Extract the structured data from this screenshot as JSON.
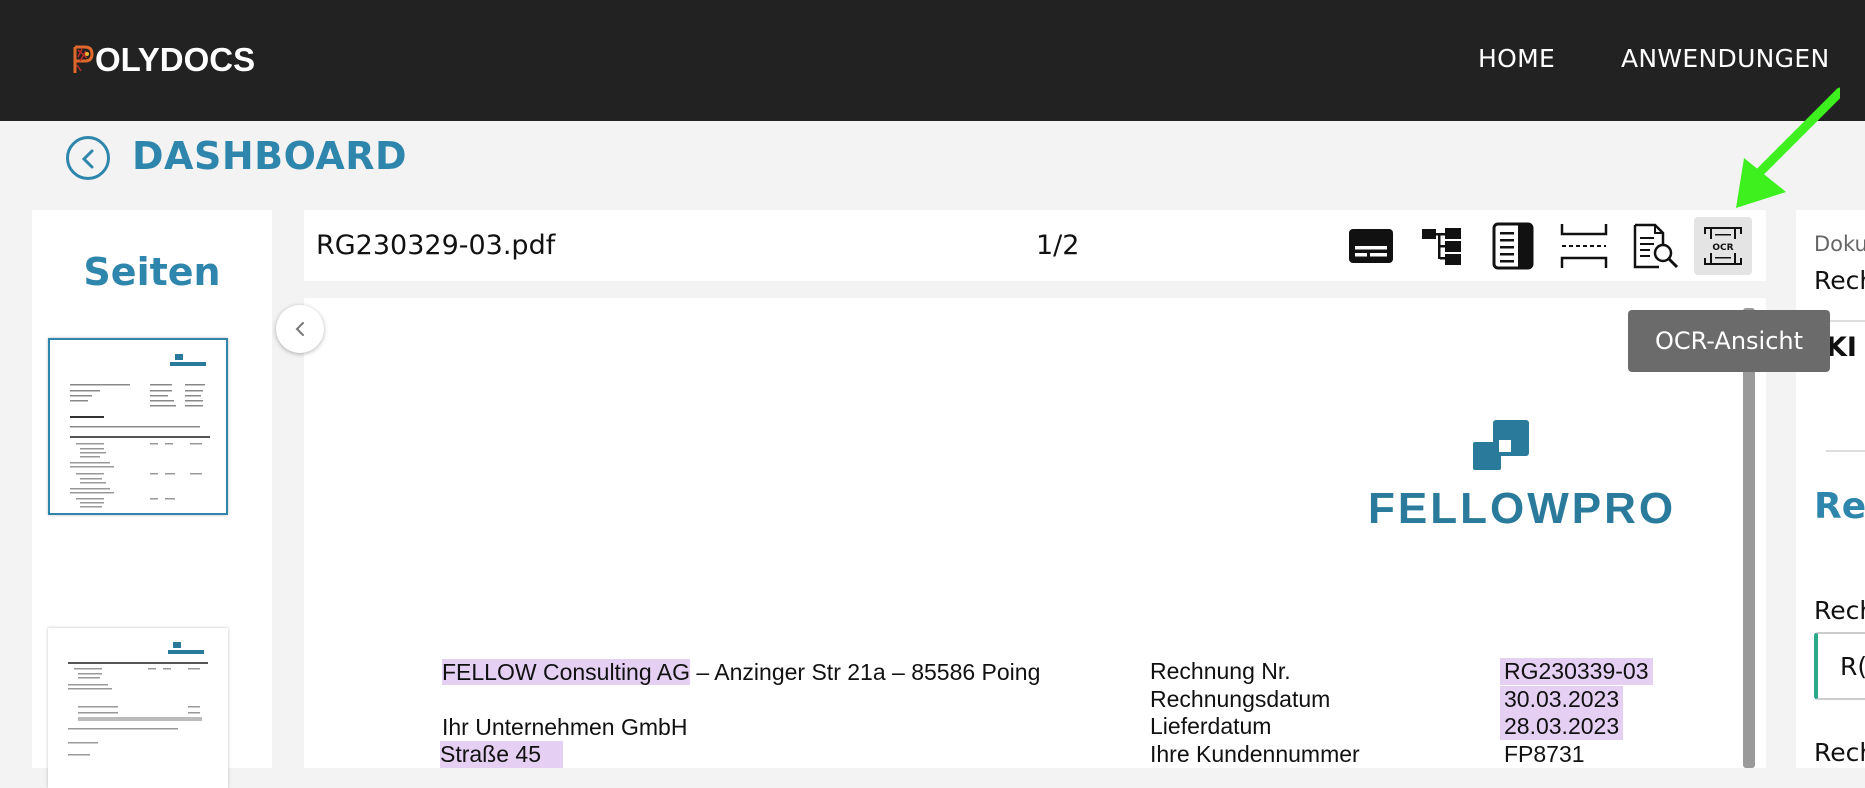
{
  "header": {
    "logo_text": "OLYDOCS",
    "nav": [
      "HOME",
      "ANWENDUNGEN"
    ]
  },
  "dashboard": {
    "title": "DASHBOARD"
  },
  "pages_panel": {
    "title": "Seiten"
  },
  "toolbar": {
    "filename": "RG230329-03.pdf",
    "page_indicator": "1/2",
    "tools": [
      "form-view-icon",
      "tree-view-icon",
      "list-view-icon",
      "page-split-icon",
      "document-search-icon",
      "ocr-view-icon"
    ],
    "ocr_icon_label": "OCR",
    "tooltip": "OCR-Ansicht"
  },
  "document": {
    "logo_text": "FELLOWPRO",
    "sender_line_company": "FELLOW Consulting AG",
    "sender_line_rest": " – Anzinger Str 21a – 85586 Poing",
    "recipient_company": "Ihr Unternehmen GmbH",
    "recipient_street": "Straße 45",
    "fields": [
      {
        "label": "Rechnung Nr.",
        "value": "RG230339-03"
      },
      {
        "label": "Rechnungsdatum",
        "value": "30.03.2023"
      },
      {
        "label": "Lieferdatum",
        "value": "28.03.2023"
      },
      {
        "label": "Ihre Kundennummer",
        "value": "FP8731"
      }
    ]
  },
  "right_panel": {
    "line1": "Doku",
    "line2": "Rech",
    "line3": "KI I",
    "section_title": "Rec",
    "field_label": "Rech",
    "field_value": "R(",
    "field_label2": "Rech"
  },
  "colors": {
    "brand": "#2f86ad",
    "header_bg": "#222222",
    "highlight": "#e5cff2",
    "annotation_arrow": "#3ef01e"
  }
}
